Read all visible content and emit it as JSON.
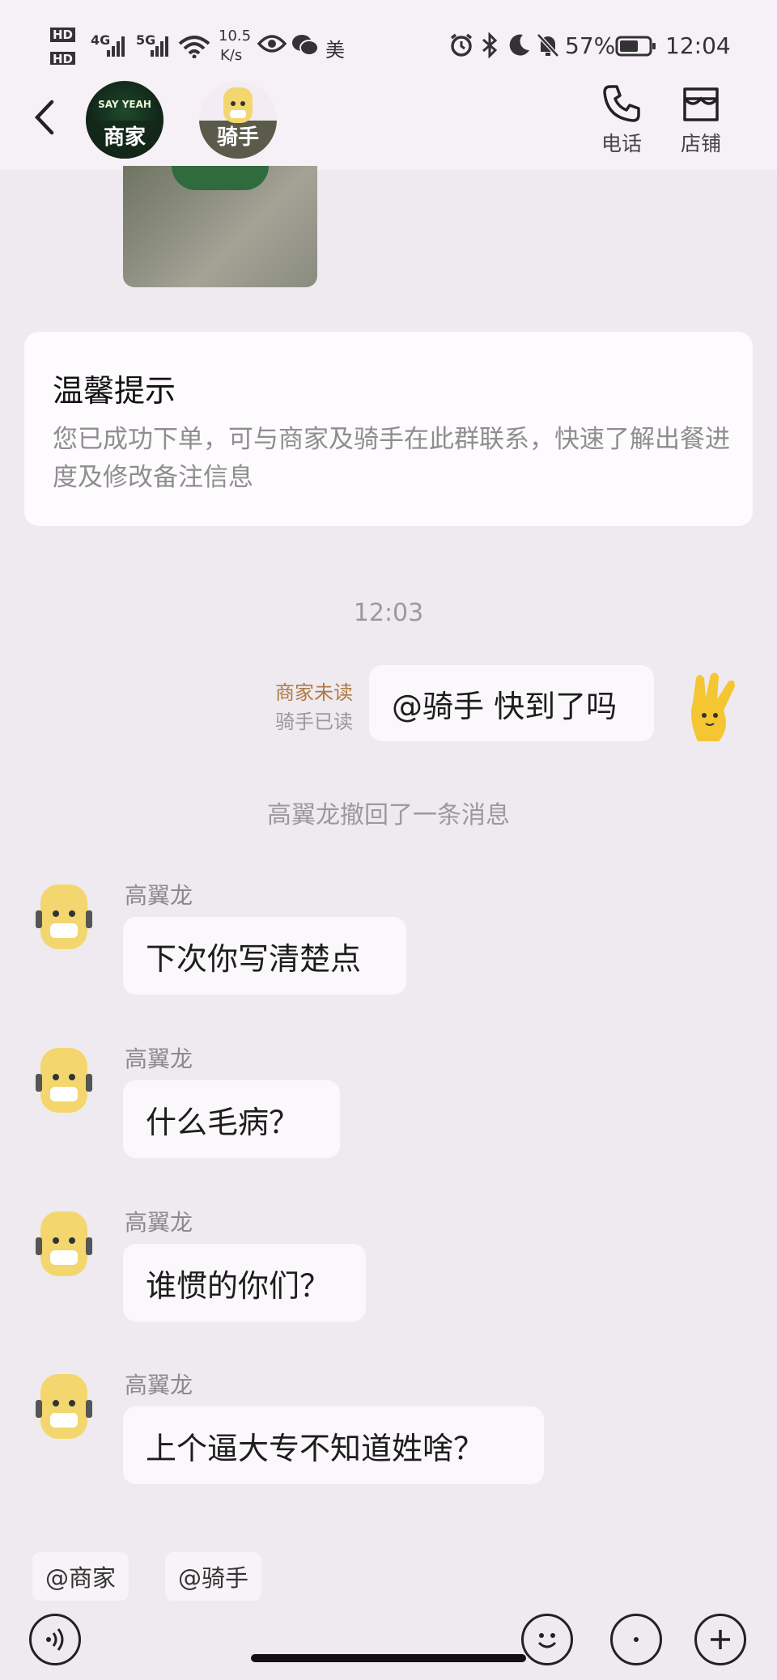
{
  "status_bar": {
    "hd1": "HD",
    "hd2": "HD",
    "net1": "4G",
    "net2": "5G",
    "speed_value": "10.5",
    "speed_unit": "K/s",
    "misc": "美",
    "battery": "57%",
    "time": "12:04"
  },
  "header": {
    "merchant_logo_text": "SAY YEAH",
    "merchant_tag": "商家",
    "rider_tag": "骑手",
    "phone_label": "电话",
    "shop_label": "店铺"
  },
  "tip": {
    "title": "温馨提示",
    "body": "您已成功下单，可与商家及骑手在此群联系，快速了解出餐进度及修改备注信息"
  },
  "chat": {
    "timestamp": "12:03",
    "my_message": {
      "text": "@骑手 快到了吗",
      "merchant_status": "商家未读",
      "rider_status": "骑手已读"
    },
    "recall_notice": "高翼龙撤回了一条消息",
    "messages": [
      {
        "sender": "高翼龙",
        "text": "下次你写清楚点"
      },
      {
        "sender": "高翼龙",
        "text": "什么毛病？"
      },
      {
        "sender": "高翼龙",
        "text": "谁惯的你们？"
      },
      {
        "sender": "高翼龙",
        "text": "上个逼大专不知道姓啥？"
      }
    ]
  },
  "mentions": [
    "@商家",
    "@骑手"
  ],
  "colors": {
    "background": "#efeaef",
    "bubble": "#fbf8fb",
    "read_status_merchant": "#b07a45",
    "rider_avatar": "#f3d76e"
  },
  "icons": [
    "back-icon",
    "phone-icon",
    "shop-icon",
    "voice-icon",
    "emoji-icon",
    "plus-icon"
  ]
}
